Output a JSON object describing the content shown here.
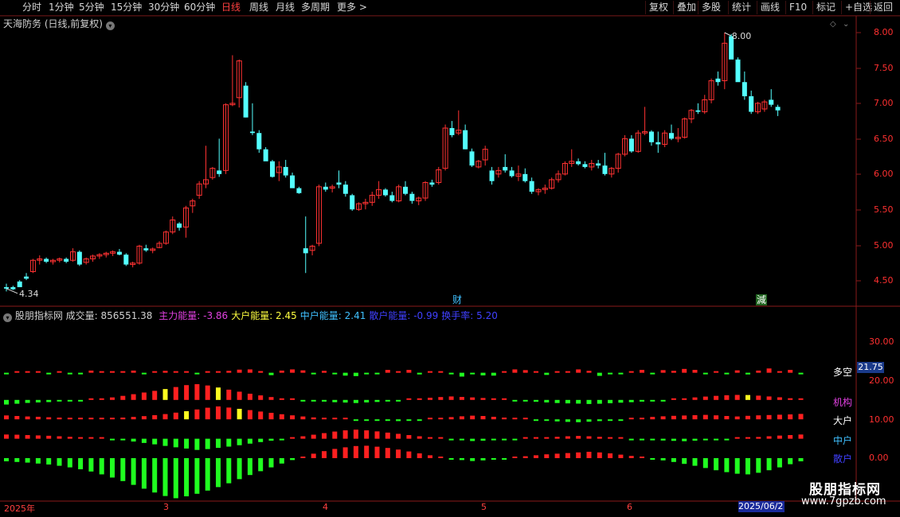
{
  "toolbar": {
    "periods": [
      "分时",
      "1分钟",
      "5分钟",
      "15分钟",
      "30分钟",
      "60分钟",
      "日线",
      "周线",
      "月线",
      "多周期",
      "更多 >"
    ],
    "active_period": "日线",
    "right_buttons": [
      "复权",
      "叠加",
      "多股",
      "统计",
      "画线",
      "F10",
      "标记",
      "+自选",
      "返回"
    ]
  },
  "main_chart": {
    "title": "天海防务 (日线,前复权)",
    "high_label": "8.00",
    "low_label": "4.34",
    "y_ticks": [
      "8.00",
      "7.50",
      "7.00",
      "6.50",
      "6.00",
      "5.50",
      "5.00",
      "4.50"
    ],
    "markers": [
      "财",
      "減"
    ]
  },
  "indicator": {
    "name": "股朋指标网",
    "volume_label": "成交量: 856551.38",
    "items": [
      {
        "text": "主力能量: -3.86",
        "color": "#e040e0"
      },
      {
        "text": "大户能量: 2.45",
        "color": "#ffff40"
      },
      {
        "text": "中户能量: 2.41",
        "color": "#40c0ff"
      },
      {
        "text": "散户能量: -0.99",
        "color": "#4040ff"
      },
      {
        "text": "换手率: 5.20",
        "color": "#4040ff"
      }
    ],
    "y_ticks": [
      "30.00",
      "20.00",
      "10.00",
      "0.00"
    ],
    "current_value": "21.75",
    "series_labels": [
      {
        "text": "多空",
        "color": "#ffffff"
      },
      {
        "text": "机构",
        "color": "#e040e0"
      },
      {
        "text": "大户",
        "color": "#ffffff"
      },
      {
        "text": "中户",
        "color": "#40c0ff"
      },
      {
        "text": "散户",
        "color": "#4040ff"
      }
    ]
  },
  "date_axis": {
    "labels": [
      "2025年",
      "3",
      "4",
      "5",
      "6"
    ],
    "current_date": "2025/06/2"
  },
  "watermark": {
    "line1": "股朋指标网",
    "line2": "www.7gpzb.com"
  },
  "chart_data": {
    "type": "candlestick",
    "ohlc": [
      [
        4.4,
        4.45,
        4.34,
        4.38
      ],
      [
        4.4,
        4.42,
        4.36,
        4.37
      ],
      [
        4.48,
        4.5,
        4.4,
        4.4
      ],
      [
        4.55,
        4.6,
        4.5,
        4.52
      ],
      [
        4.62,
        4.8,
        4.6,
        4.78
      ],
      [
        4.78,
        4.85,
        4.72,
        4.8
      ],
      [
        4.8,
        4.82,
        4.74,
        4.76
      ],
      [
        4.76,
        4.8,
        4.72,
        4.78
      ],
      [
        4.78,
        4.82,
        4.75,
        4.8
      ],
      [
        4.8,
        4.82,
        4.74,
        4.76
      ],
      [
        4.78,
        4.95,
        4.76,
        4.9
      ],
      [
        4.9,
        4.92,
        4.7,
        4.72
      ],
      [
        4.75,
        4.82,
        4.72,
        4.8
      ],
      [
        4.8,
        4.86,
        4.76,
        4.84
      ],
      [
        4.84,
        4.88,
        4.8,
        4.86
      ],
      [
        4.86,
        4.9,
        4.82,
        4.88
      ],
      [
        4.88,
        4.92,
        4.84,
        4.9
      ],
      [
        4.9,
        4.94,
        4.85,
        4.86
      ],
      [
        4.86,
        4.88,
        4.7,
        4.72
      ],
      [
        4.72,
        4.76,
        4.68,
        4.74
      ],
      [
        4.74,
        5.0,
        4.72,
        4.98
      ],
      [
        4.95,
        5.0,
        4.9,
        4.92
      ],
      [
        4.92,
        4.96,
        4.88,
        4.94
      ],
      [
        4.96,
        5.05,
        4.95,
        5.02
      ],
      [
        5.02,
        5.2,
        5.0,
        5.18
      ],
      [
        5.18,
        5.4,
        5.15,
        5.35
      ],
      [
        5.3,
        5.32,
        5.2,
        5.24
      ],
      [
        5.25,
        5.55,
        5.1,
        5.52
      ],
      [
        5.55,
        5.65,
        5.45,
        5.62
      ],
      [
        5.7,
        5.9,
        5.65,
        5.86
      ],
      [
        5.86,
        6.4,
        5.8,
        5.92
      ],
      [
        5.95,
        6.1,
        5.92,
        6.08
      ],
      [
        6.05,
        6.5,
        5.96,
        6.0
      ],
      [
        6.05,
        7.0,
        6.0,
        6.98
      ],
      [
        6.98,
        7.68,
        6.96,
        7.0
      ],
      [
        7.08,
        7.62,
        6.94,
        7.6
      ],
      [
        7.25,
        7.3,
        6.8,
        6.8
      ],
      [
        6.6,
        7.0,
        6.55,
        6.58
      ],
      [
        6.58,
        6.62,
        6.3,
        6.35
      ],
      [
        6.35,
        6.38,
        6.2,
        6.18
      ],
      [
        6.18,
        6.2,
        5.95,
        5.96
      ],
      [
        6.02,
        6.18,
        5.9,
        6.1
      ],
      [
        6.1,
        6.2,
        5.95,
        5.98
      ],
      [
        5.98,
        6.02,
        5.8,
        5.8
      ],
      [
        5.8,
        5.82,
        5.72,
        5.73
      ],
      [
        4.95,
        5.4,
        4.6,
        4.88
      ],
      [
        4.92,
        5.0,
        4.85,
        4.98
      ],
      [
        5.02,
        5.85,
        4.98,
        5.82
      ],
      [
        5.82,
        5.88,
        5.75,
        5.78
      ],
      [
        5.8,
        5.85,
        5.74,
        5.82
      ],
      [
        5.88,
        6.05,
        5.8,
        5.85
      ],
      [
        5.85,
        5.9,
        5.68,
        5.72
      ],
      [
        5.7,
        5.72,
        5.48,
        5.5
      ],
      [
        5.5,
        5.6,
        5.48,
        5.58
      ],
      [
        5.58,
        5.65,
        5.5,
        5.6
      ],
      [
        5.6,
        5.75,
        5.55,
        5.7
      ],
      [
        5.7,
        5.9,
        5.65,
        5.78
      ],
      [
        5.78,
        5.8,
        5.68,
        5.7
      ],
      [
        5.7,
        5.75,
        5.6,
        5.62
      ],
      [
        5.62,
        5.85,
        5.6,
        5.82
      ],
      [
        5.82,
        5.9,
        5.7,
        5.72
      ],
      [
        5.72,
        5.75,
        5.58,
        5.62
      ],
      [
        5.62,
        5.68,
        5.56,
        5.66
      ],
      [
        5.66,
        5.9,
        5.62,
        5.88
      ],
      [
        5.88,
        5.92,
        5.82,
        5.85
      ],
      [
        5.88,
        6.1,
        5.85,
        6.06
      ],
      [
        6.08,
        6.7,
        6.05,
        6.65
      ],
      [
        6.65,
        6.75,
        6.52,
        6.55
      ],
      [
        6.58,
        6.9,
        6.55,
        6.62
      ],
      [
        6.62,
        6.7,
        6.35,
        6.35
      ],
      [
        6.32,
        6.36,
        6.1,
        6.12
      ],
      [
        6.1,
        6.2,
        6.08,
        6.18
      ],
      [
        6.2,
        6.4,
        6.12,
        6.35
      ],
      [
        6.05,
        6.1,
        5.85,
        5.9
      ],
      [
        6.0,
        6.1,
        5.95,
        6.05
      ],
      [
        6.1,
        6.28,
        6.02,
        6.05
      ],
      [
        6.05,
        6.1,
        5.95,
        5.97
      ],
      [
        5.97,
        6.12,
        5.9,
        6.0
      ],
      [
        6.0,
        6.08,
        5.88,
        5.9
      ],
      [
        5.9,
        5.95,
        5.72,
        5.75
      ],
      [
        5.75,
        5.8,
        5.7,
        5.78
      ],
      [
        5.78,
        5.85,
        5.72,
        5.8
      ],
      [
        5.8,
        5.95,
        5.78,
        5.92
      ],
      [
        5.92,
        6.05,
        5.88,
        6.0
      ],
      [
        6.0,
        6.18,
        5.98,
        6.15
      ],
      [
        6.15,
        6.35,
        6.1,
        6.18
      ],
      [
        6.18,
        6.22,
        6.12,
        6.14
      ],
      [
        6.14,
        6.18,
        6.08,
        6.1
      ],
      [
        6.1,
        6.2,
        6.05,
        6.15
      ],
      [
        6.15,
        6.2,
        6.08,
        6.12
      ],
      [
        6.12,
        6.3,
        5.98,
        6.0
      ],
      [
        6.0,
        6.1,
        5.95,
        6.08
      ],
      [
        6.08,
        6.3,
        6.02,
        6.28
      ],
      [
        6.28,
        6.55,
        6.25,
        6.5
      ],
      [
        6.5,
        6.55,
        6.3,
        6.32
      ],
      [
        6.32,
        6.62,
        6.3,
        6.58
      ],
      [
        6.58,
        6.95,
        6.55,
        6.6
      ],
      [
        6.6,
        6.62,
        6.4,
        6.45
      ],
      [
        6.45,
        6.6,
        6.3,
        6.42
      ],
      [
        6.42,
        6.62,
        6.38,
        6.58
      ],
      [
        6.58,
        6.7,
        6.48,
        6.5
      ],
      [
        6.5,
        6.65,
        6.45,
        6.52
      ],
      [
        6.52,
        6.8,
        6.5,
        6.78
      ],
      [
        6.78,
        6.92,
        6.72,
        6.9
      ],
      [
        6.9,
        7.0,
        6.85,
        6.88
      ],
      [
        6.88,
        7.12,
        6.85,
        7.05
      ],
      [
        7.05,
        7.35,
        7.0,
        7.32
      ],
      [
        7.35,
        7.45,
        7.25,
        7.3
      ],
      [
        7.32,
        8.0,
        7.2,
        7.85
      ],
      [
        7.95,
        7.98,
        7.65,
        7.62
      ],
      [
        7.62,
        7.65,
        7.32,
        7.3
      ],
      [
        7.3,
        7.45,
        7.05,
        7.1
      ],
      [
        7.1,
        7.18,
        6.85,
        6.88
      ],
      [
        6.88,
        7.02,
        6.85,
        7.0
      ],
      [
        6.92,
        7.05,
        6.88,
        7.02
      ],
      [
        7.05,
        7.2,
        6.95,
        6.98
      ],
      [
        6.95,
        6.98,
        6.82,
        6.9
      ]
    ],
    "indicator": {
      "multi_empty": {
        "value": 21.75,
        "values": [
          21.75,
          22.6,
          22.4,
          22.66,
          21.7,
          22.0,
          21.4,
          21.7,
          22.9,
          22.2,
          22.6,
          22.1,
          22.9,
          21.4,
          22.0,
          22.8,
          22.2,
          22.6,
          21.8,
          22.2,
          22.1,
          22.8,
          23.3,
          23.4,
          22.7,
          21.0,
          22.9,
          23.4,
          23.0,
          21.6,
          22.8,
          21.4,
          20.8,
          20.6,
          21.9,
          21.4,
          23.2,
          22.1,
          23.2,
          21.3,
          22.1,
          22.2,
          21.5,
          20.4,
          21.8,
          20.9,
          20.8,
          22.3,
          23.4,
          23.1,
          22.4,
          21.1,
          22.5,
          22.6,
          23.4,
          22.8,
          20.7,
          21.7,
          21.8,
          22.4,
          23.2,
          21.9,
          23.1,
          22.8,
          23.6,
          23.2,
          21.9,
          22.3,
          21.6,
          23.0,
          21.3,
          22.9,
          23.8,
          22.5,
          23.2,
          21.7
        ]
      },
      "institution": [
        -3.86,
        -3.2,
        -2.5,
        -2.1,
        -1.8,
        -1.2,
        -0.8,
        -0.3,
        0.4,
        1.2,
        2.1,
        3.4,
        4.8,
        6.2,
        7.6,
        9.1,
        10.8,
        12.4,
        13.2,
        12.1,
        10.4,
        8.6,
        6.9,
        5.2,
        3.8,
        2.4,
        1.2,
        0.6,
        -0.2,
        -0.8,
        -1.4,
        -1.9,
        -2.2,
        -2.6,
        -2.1,
        -1.7,
        -1.2,
        -0.6,
        0.3,
        1.1,
        1.8,
        2.4,
        2.9,
        2.5,
        2.1,
        1.6,
        1.1,
        0.6,
        -0.2,
        -0.9,
        -1.5,
        -2.1,
        -2.6,
        -2.9,
        -3.1,
        -3.4,
        -3.2,
        -2.8,
        -2.3,
        -1.9,
        -1.4,
        -0.8,
        -0.2,
        0.4,
        1.2,
        2.1,
        2.8,
        3.4,
        3.9,
        4.2,
        4.1,
        3.6,
        2.9,
        2.2,
        1.4,
        0.6
      ],
      "large_holder": [
        2.45,
        2.1,
        1.8,
        1.6,
        1.3,
        1.1,
        0.9,
        0.8,
        0.7,
        0.6,
        0.8,
        1.1,
        1.5,
        2.0,
        2.6,
        3.3,
        4.2,
        5.1,
        6.2,
        7.3,
        8.1,
        7.4,
        6.6,
        5.8,
        4.9,
        4.1,
        3.2,
        2.5,
        1.8,
        1.2,
        0.7,
        0.4,
        0.1,
        -0.2,
        -0.5,
        -0.7,
        -0.9,
        -1.1,
        -0.8,
        -0.4,
        0.2,
        0.8,
        1.4,
        1.9,
        2.3,
        2.1,
        1.6,
        1.1,
        0.6,
        0.1,
        -0.4,
        -0.9,
        -1.3,
        -1.6,
        -1.8,
        -1.5,
        -1.1,
        -0.6,
        -0.1,
        0.4,
        0.9,
        1.5,
        1.9,
        2.2,
        2.4,
        2.6,
        2.8,
        2.5,
        2.1,
        1.8,
        2.2,
        2.5,
        2.7,
        2.9,
        3.1,
        3.4
      ],
      "mid_holder": [
        2.41,
        2.3,
        2.1,
        1.9,
        1.7,
        1.4,
        1.1,
        0.8,
        0.4,
        0.1,
        -0.4,
        -0.9,
        -1.6,
        -2.4,
        -3.2,
        -4.1,
        -4.9,
        -5.6,
        -6.4,
        -5.9,
        -5.2,
        -4.5,
        -3.7,
        -2.8,
        -1.9,
        -1.1,
        -0.3,
        0.5,
        1.4,
        2.3,
        3.2,
        4.1,
        4.8,
        5.2,
        4.8,
        4.2,
        3.5,
        2.8,
        2.1,
        1.4,
        0.7,
        0.1,
        -0.4,
        -0.9,
        -1.3,
        -1.1,
        -0.8,
        -0.5,
        -0.2,
        0.1,
        0.4,
        0.8,
        1.1,
        1.4,
        1.6,
        1.4,
        1.1,
        0.7,
        0.3,
        -0.1,
        -0.5,
        -0.8,
        -1.0,
        -1.2,
        -1.4,
        -1.1,
        -0.8,
        -0.5,
        -0.2,
        0.2,
        0.6,
        1.0,
        1.4,
        1.8,
        2.1,
        2.41
      ],
      "retail": [
        -0.99,
        -1.2,
        -1.4,
        -1.7,
        -2.0,
        -2.4,
        -2.9,
        -3.5,
        -4.2,
        -5.1,
        -6.1,
        -7.2,
        -8.4,
        -9.6,
        -10.8,
        -11.9,
        -12.6,
        -12.0,
        -11.2,
        -10.2,
        -9.1,
        -7.9,
        -6.6,
        -5.3,
        -4.1,
        -2.9,
        -1.7,
        -0.6,
        0.5,
        1.4,
        2.2,
        2.9,
        3.4,
        3.8,
        3.9,
        3.6,
        3.2,
        2.7,
        2.1,
        1.5,
        0.9,
        0.3,
        -0.2,
        -0.6,
        -0.9,
        -0.7,
        -0.4,
        -0.1,
        0.3,
        0.6,
        0.9,
        1.2,
        1.4,
        1.6,
        1.8,
        2.0,
        1.8,
        1.5,
        1.1,
        0.7,
        0.3,
        -0.2,
        -0.7,
        -1.2,
        -1.8,
        -2.4,
        -3.1,
        -3.8,
        -4.4,
        -4.9,
        -5.1,
        -4.6,
        -3.8,
        -2.9,
        -1.9,
        -0.99
      ]
    }
  }
}
